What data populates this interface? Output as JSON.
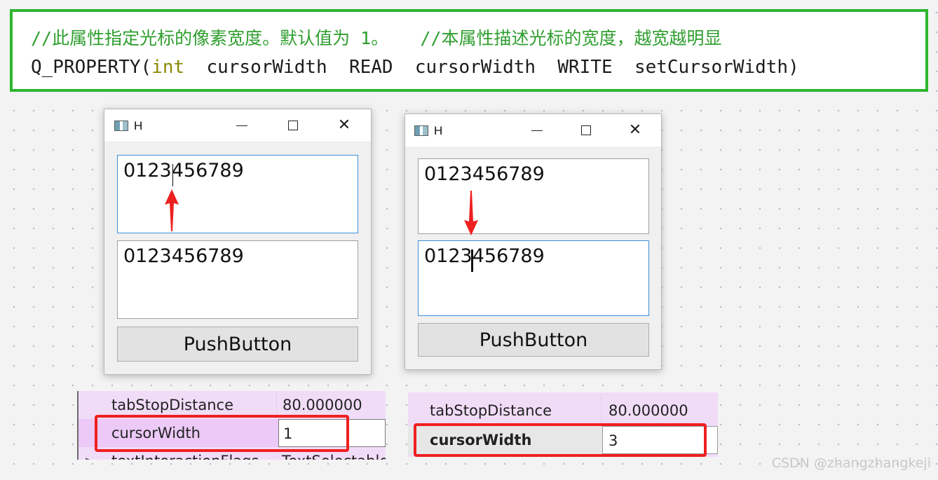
{
  "code": {
    "comment": "//此属性指定光标的像素宽度。默认值为 1。   //本属性描述光标的宽度，越宽越明显",
    "macro": "Q_PROPERTY(",
    "type_kw": "int",
    "rest": "  cursorWidth  READ  cursorWidth  WRITE  setCursorWidth)"
  },
  "window_left": {
    "title": "H",
    "edit1_text": "0123456789",
    "edit2_text": "0123456789",
    "button_label": "PushButton"
  },
  "window_right": {
    "title": "H",
    "edit1_text": "0123456789",
    "edit2_text": "0123456789",
    "button_label": "PushButton"
  },
  "props_left": {
    "rows": [
      {
        "name": "tabStopDistance",
        "value": "80.000000"
      },
      {
        "name": "cursorWidth",
        "value": "1"
      },
      {
        "name": "textInteractionFlags",
        "value": "TextSelectable"
      }
    ]
  },
  "props_right": {
    "rows": [
      {
        "name": "tabStopDistance",
        "value": "80.000000"
      },
      {
        "name": "cursorWidth",
        "value": "3"
      }
    ]
  },
  "watermark": "CSDN @zhangzhangkeji",
  "colors": {
    "code_border": "#2fb52f",
    "comment": "#2f9e2f",
    "highlight": "#ee2020",
    "property_row": "#f1dcf8",
    "focus_border": "#3c8fd6"
  }
}
